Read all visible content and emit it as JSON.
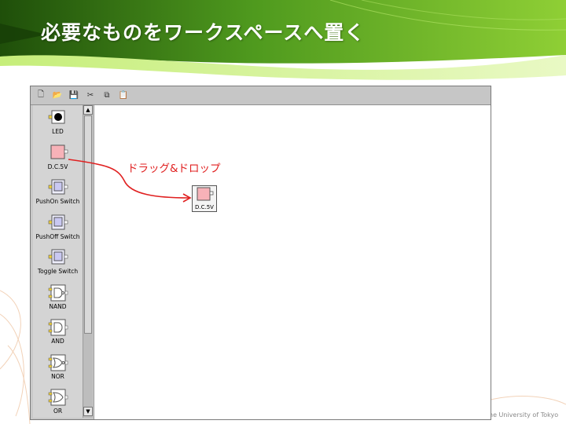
{
  "slide": {
    "title": "必要なものをワークスペースへ置く",
    "footer": "he University of Tokyo",
    "accent_dark": "#2f6a10",
    "accent_light": "#9bd43a"
  },
  "toolbar": {
    "buttons": [
      {
        "name": "new-file-icon",
        "glyph": "🗋"
      },
      {
        "name": "open-folder-icon",
        "glyph": "📂"
      },
      {
        "name": "save-icon",
        "glyph": "💾"
      },
      {
        "name": "cut-icon",
        "glyph": "✂"
      },
      {
        "name": "copy-icon",
        "glyph": "⧉"
      },
      {
        "name": "paste-icon",
        "glyph": "📋"
      }
    ]
  },
  "palette": {
    "items": [
      {
        "label": "LED",
        "type": "led"
      },
      {
        "label": "D.C.5V",
        "type": "dc"
      },
      {
        "label": "PushOn Switch",
        "type": "switch"
      },
      {
        "label": "PushOff Switch",
        "type": "switch"
      },
      {
        "label": "Toggle Switch",
        "type": "switch"
      },
      {
        "label": "NAND",
        "type": "nand"
      },
      {
        "label": "AND",
        "type": "and"
      },
      {
        "label": "NOR",
        "type": "nor"
      },
      {
        "label": "OR",
        "type": "or"
      }
    ]
  },
  "workspace": {
    "placed_component_label": "D.C.5V"
  },
  "annotation": {
    "drag_label": "ドラッグ&ドロップ",
    "arrow_color": "#e02020"
  }
}
